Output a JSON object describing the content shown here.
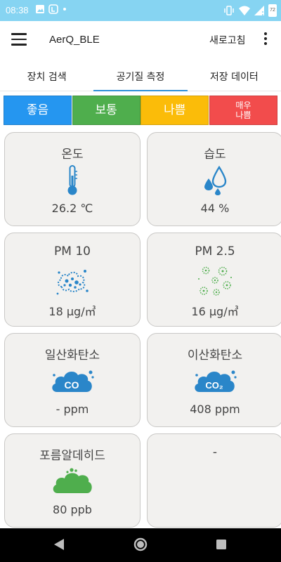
{
  "status": {
    "time": "08:38",
    "battery": "72"
  },
  "app": {
    "title": "AerQ_BLE",
    "refresh_label": "새로고침"
  },
  "tabs": [
    {
      "label": "장치 검색"
    },
    {
      "label": "공기질 측정"
    },
    {
      "label": "저장 데이터"
    }
  ],
  "legend": [
    {
      "label": "좋음",
      "color": "#2596f0"
    },
    {
      "label": "보통",
      "color": "#4fae4d"
    },
    {
      "label": "나쁨",
      "color": "#fbbc09"
    },
    {
      "label": "매우\n나쁨",
      "color": "#f24c4c"
    }
  ],
  "cards": {
    "temperature": {
      "title": "온도",
      "value": "26.2 ℃",
      "icon": "thermometer-icon"
    },
    "humidity": {
      "title": "습도",
      "value": "44 %",
      "icon": "water-drops-icon"
    },
    "pm10": {
      "title": "PM 10",
      "value": "18 μg/㎥",
      "icon": "pm10-particles-icon"
    },
    "pm25": {
      "title": "PM 2.5",
      "value": "16 μg/㎥",
      "icon": "pm25-particles-icon"
    },
    "co": {
      "title": "일산화탄소",
      "value": "- ppm",
      "icon": "co-cloud-icon",
      "icon_text": "CO"
    },
    "co2": {
      "title": "이산화탄소",
      "value": "408 ppm",
      "icon": "co2-cloud-icon",
      "icon_text": "CO₂"
    },
    "hcho": {
      "title": "포름알데히드",
      "value": "80 ppb",
      "icon": "hcho-cloud-icon"
    },
    "empty": {
      "title": "-",
      "value": ""
    }
  },
  "colors": {
    "accent": "#2e8fd8",
    "icon_blue": "#2a86c9",
    "icon_green": "#4fae4d",
    "statusbar": "#86d4f2"
  }
}
